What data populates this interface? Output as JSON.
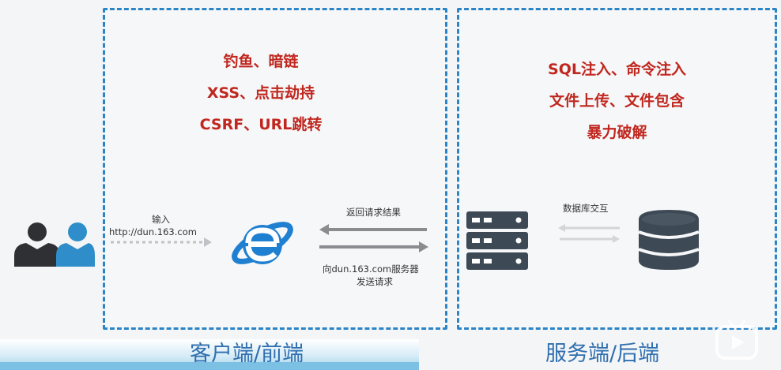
{
  "client": {
    "threats": [
      "钓鱼、暗链",
      "XSS、点击劫持",
      "CSRF、URL跳转"
    ],
    "input_label": "输入",
    "url": "http://dun.163.com",
    "response_label": "返回请求结果",
    "request_label_line1": "向dun.163.com服务器",
    "request_label_line2": "发送请求",
    "footer": "客户端/前端"
  },
  "server": {
    "threats": [
      "SQL注入、命令注入",
      "文件上传、文件包含",
      "暴力破解"
    ],
    "db_label": "数据库交互",
    "footer": "服务端/后端"
  },
  "colors": {
    "border": "#2a84c6",
    "threat_text": "#c0271f",
    "user_dark": "#2e3033",
    "user_blue": "#2f8ec9",
    "ie_blue": "#1f7fd0",
    "server_icon": "#3d4954",
    "footer_text": "#2f6fb0"
  },
  "icons": [
    "users-icon",
    "ie-browser-icon",
    "server-icon",
    "database-icon",
    "play-icon"
  ]
}
